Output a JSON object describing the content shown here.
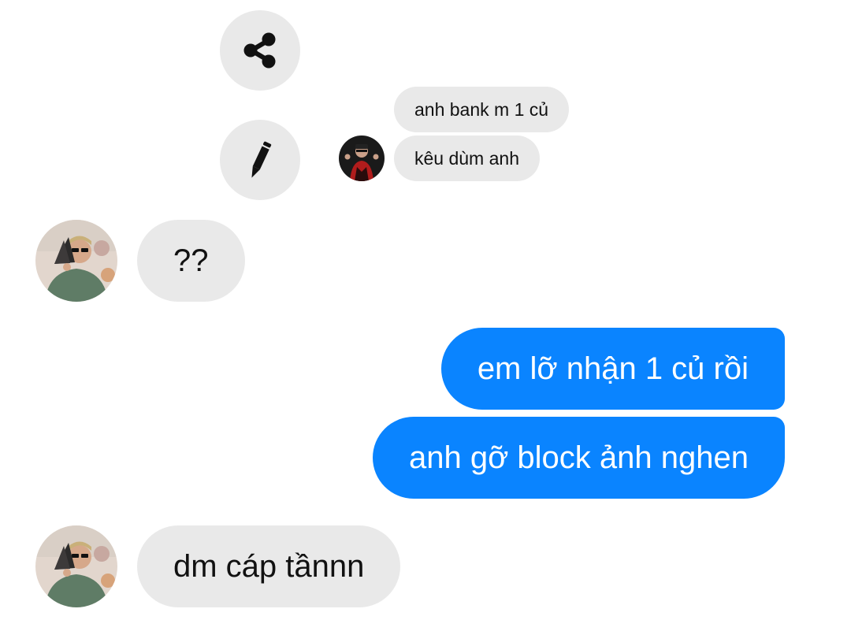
{
  "quoted_thread": {
    "messages": [
      {
        "text": "anh bank m 1 củ"
      },
      {
        "text": "kêu dùm anh"
      }
    ]
  },
  "actions": {
    "share_icon": "share-icon",
    "edit_icon": "pencil-icon"
  },
  "conversation": {
    "messages": [
      {
        "side": "incoming",
        "text": "??"
      },
      {
        "side": "outgoing",
        "text": "em lỡ nhận 1 củ rồi"
      },
      {
        "side": "outgoing",
        "text": "anh gỡ block ảnh nghen"
      },
      {
        "side": "incoming",
        "text": "dm cáp tầnnn"
      }
    ]
  },
  "colors": {
    "outgoing_bubble": "#0a84ff",
    "incoming_bubble": "#e9e9e9",
    "action_button": "#e9e9e9"
  }
}
